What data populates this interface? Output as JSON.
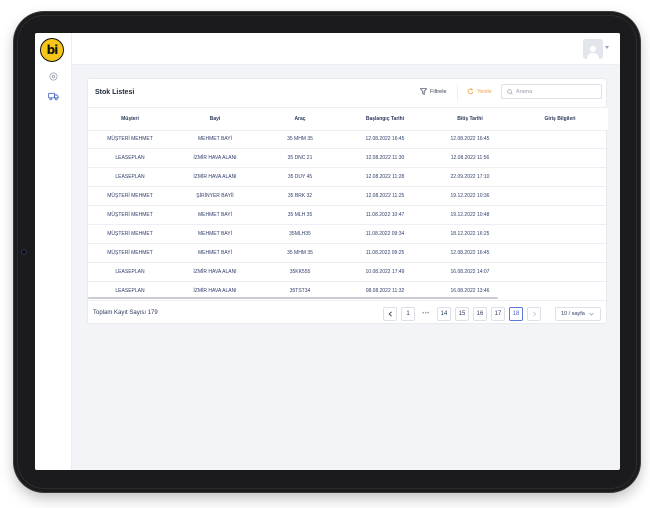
{
  "app": {
    "logo_text": "bi"
  },
  "sidebar": {
    "items": [
      {
        "icon": "settings-circle-icon"
      },
      {
        "icon": "truck-icon"
      }
    ]
  },
  "header": {
    "avatar_icon": "user-icon"
  },
  "card": {
    "title": "Stok Listesi",
    "filter_label": "Filtrele",
    "refresh_label": "Yenile",
    "search_placeholder": "Arama"
  },
  "table": {
    "columns": [
      "Müşteri",
      "Bayi",
      "Araç",
      "Başlangıç Tarihi",
      "Bitiş Tarihi",
      "Giriş Bilgileri"
    ],
    "rows": [
      [
        "MÜŞTERİ MEHMET",
        "MEHMET BAYİ",
        "35 MHM 35",
        "12.08.2022 16:45",
        "12.08.2022 16:45",
        ""
      ],
      [
        "LEASEPLAN",
        "İZMİR HAVA ALANI",
        "35 DNC 21",
        "12.08.2022 11:30",
        "12.08.2022 11:56",
        ""
      ],
      [
        "LEASEPLAN",
        "İZMİR HAVA ALANI",
        "35 DUY 45",
        "12.08.2022 11:28",
        "22.09.2022 17:10",
        ""
      ],
      [
        "MÜŞTERİ MEHMET",
        "ŞİRİNYER BAYİİ",
        "35 BRK 32",
        "12.08.2022 11:25",
        "19.12.2022 10:36",
        ""
      ],
      [
        "MÜŞTERİ MEHMET",
        "MEHMET BAYİ",
        "35 MLH 35",
        "11.08.2022 10:47",
        "19.12.2022 10:48",
        ""
      ],
      [
        "MÜŞTERİ MEHMET",
        "MEHMET BAYİ",
        "35MLH35",
        "11.08.2022 09:34",
        "18.12.2022 16:25",
        ""
      ],
      [
        "MÜŞTERİ MEHMET",
        "MEHMET BAYİ",
        "35 MHM 35",
        "11.08.2022 09:25",
        "12.08.2022 16:45",
        ""
      ],
      [
        "LEASEPLAN",
        "İZMİR HAVA ALANI",
        "35KK555",
        "10.08.2022 17:49",
        "16.08.2022 14:07",
        ""
      ],
      [
        "LEASEPLAN",
        "İZMİR HAVA ALANI",
        "35TST34",
        "08.08.2022 11:32",
        "16.08.2022 13:46",
        ""
      ]
    ]
  },
  "footer": {
    "total_label": "Toplam Kayıt Sayısı 179",
    "pages": [
      "1",
      "•••",
      "14",
      "15",
      "16",
      "17",
      "18"
    ],
    "active_page": "18",
    "page_size": "10 / sayfa"
  },
  "colors": {
    "accent": "#4a66c8",
    "refresh": "#f0a23a",
    "logo": "#f5c518"
  }
}
